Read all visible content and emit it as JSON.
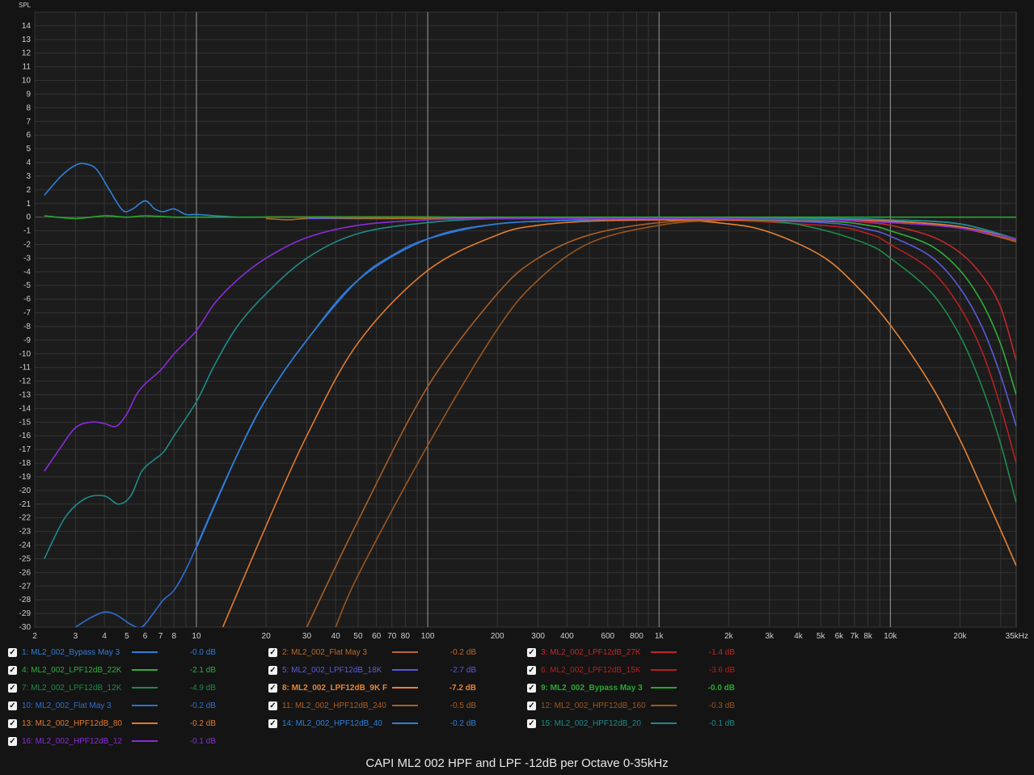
{
  "chart_data": {
    "type": "line",
    "title": "CAPI ML2 002 HPF and LPF -12dB per Octave 0-35kHz",
    "ylabel": "SPL",
    "xscale": "log",
    "xlim": [
      2,
      35000
    ],
    "ylim": [
      -30,
      15
    ],
    "grid": true,
    "y_ticks": [
      "14",
      "13",
      "12",
      "11",
      "10",
      "9",
      "8",
      "7",
      "6",
      "5",
      "4",
      "3",
      "2",
      "1",
      "0",
      "-1",
      "-2",
      "-3",
      "-4",
      "-5",
      "-6",
      "-7",
      "-8",
      "-9",
      "-10",
      "-11",
      "-12",
      "-13",
      "-14",
      "-15",
      "-16",
      "-17",
      "-18",
      "-19",
      "-20",
      "-21",
      "-22",
      "-23",
      "-24",
      "-25",
      "-26",
      "-27",
      "-28",
      "-29",
      "-30"
    ],
    "x_ticks": [
      {
        "v": 2,
        "label": "2"
      },
      {
        "v": 3,
        "label": "3"
      },
      {
        "v": 4,
        "label": "4"
      },
      {
        "v": 5,
        "label": "5"
      },
      {
        "v": 6,
        "label": "6"
      },
      {
        "v": 7,
        "label": "7"
      },
      {
        "v": 8,
        "label": "8"
      },
      {
        "v": 10,
        "label": "10"
      },
      {
        "v": 20,
        "label": "20"
      },
      {
        "v": 30,
        "label": "30"
      },
      {
        "v": 40,
        "label": "40"
      },
      {
        "v": 50,
        "label": "50"
      },
      {
        "v": 60,
        "label": "60"
      },
      {
        "v": 70,
        "label": "70"
      },
      {
        "v": 80,
        "label": "80"
      },
      {
        "v": 100,
        "label": "100"
      },
      {
        "v": 200,
        "label": "200"
      },
      {
        "v": 300,
        "label": "300"
      },
      {
        "v": 400,
        "label": "400"
      },
      {
        "v": 600,
        "label": "600"
      },
      {
        "v": 800,
        "label": "800"
      },
      {
        "v": 1000,
        "label": "1k"
      },
      {
        "v": 2000,
        "label": "2k"
      },
      {
        "v": 3000,
        "label": "3k"
      },
      {
        "v": 4000,
        "label": "4k"
      },
      {
        "v": 5000,
        "label": "5k"
      },
      {
        "v": 6000,
        "label": "6k"
      },
      {
        "v": 7000,
        "label": "7k"
      },
      {
        "v": 8000,
        "label": "8k"
      },
      {
        "v": 10000,
        "label": "10k"
      },
      {
        "v": 20000,
        "label": "20k"
      },
      {
        "v": 35000,
        "label": "35kHz"
      }
    ],
    "series": [
      {
        "name": "1: ML2_002_Bypass May 3",
        "value_label": "-0.0 dB",
        "color": "#2f7fd8",
        "x": [
          2.2,
          2.6,
          3,
          3.3,
          3.7,
          4.2,
          4.8,
          5.3,
          6,
          6.6,
          7.2,
          8,
          9,
          10,
          12,
          15,
          20
        ],
        "y": [
          1.6,
          3.0,
          3.8,
          3.9,
          3.5,
          2.0,
          0.5,
          0.6,
          1.2,
          0.6,
          0.4,
          0.6,
          0.2,
          0.2,
          0.1,
          0.0,
          0.0
        ]
      },
      {
        "name": "2: ML2_002_Flat May 3",
        "value_label": "-0.2 dB",
        "color": "#b86a2c",
        "x": [
          20,
          25,
          30,
          50,
          100,
          500,
          1000,
          5000,
          10000,
          20000,
          35000
        ],
        "y": [
          -0.1,
          -0.2,
          -0.1,
          -0.1,
          -0.1,
          -0.1,
          -0.1,
          -0.2,
          -0.3,
          -0.7,
          -1.8
        ]
      },
      {
        "name": "3: ML2_002_LPF12dB_27K",
        "value_label": "-1.4 dB",
        "color": "#c02828",
        "x": [
          20,
          100,
          1000,
          5000,
          8000,
          10000,
          15000,
          20000,
          25000,
          30000,
          35000
        ],
        "y": [
          0,
          0,
          -0.1,
          -0.2,
          -0.4,
          -0.6,
          -1.4,
          -2.6,
          -4.3,
          -6.6,
          -10.5
        ]
      },
      {
        "name": "4: ML2_002_LPF12dB_22K",
        "value_label": "-2.1 dB",
        "color": "#2fae3a",
        "x": [
          20,
          100,
          1000,
          5000,
          8000,
          10000,
          15000,
          20000,
          25000,
          30000,
          35000
        ],
        "y": [
          0,
          0,
          -0.1,
          -0.3,
          -0.6,
          -1.0,
          -2.1,
          -3.9,
          -6.3,
          -9.3,
          -13.0
        ]
      },
      {
        "name": "5: ML2_002_LPF12dB_18K",
        "value_label": "-2.7 dB",
        "color": "#5a5ad8",
        "x": [
          30,
          100,
          1000,
          5000,
          8000,
          10000,
          15000,
          20000,
          25000,
          30000,
          35000
        ],
        "y": [
          -0.1,
          0,
          -0.1,
          -0.4,
          -0.9,
          -1.4,
          -2.9,
          -5.2,
          -8.1,
          -11.6,
          -15.3
        ]
      },
      {
        "name": "6: ML2_002_LPF12dB_15K",
        "value_label": "-3.6 dB",
        "color": "#b81f1f",
        "x": [
          20,
          100,
          1000,
          5000,
          8000,
          10000,
          15000,
          20000,
          25000,
          30000,
          35000
        ],
        "y": [
          0,
          0,
          -0.1,
          -0.6,
          -1.2,
          -2.0,
          -3.9,
          -6.6,
          -9.9,
          -13.9,
          -18.0
        ]
      },
      {
        "name": "7: ML2_002_LPF12dB_12K",
        "value_label": "-4.9 dB",
        "color": "#1f8a4a",
        "x": [
          20,
          100,
          1000,
          3000,
          5000,
          8000,
          10000,
          15000,
          20000,
          25000,
          30000,
          35000
        ],
        "y": [
          0,
          0,
          -0.1,
          -0.3,
          -0.9,
          -2.0,
          -3.0,
          -5.5,
          -8.7,
          -12.5,
          -16.6,
          -20.9
        ]
      },
      {
        "name": "8: ML2_002_LPF12dB_9K F",
        "value_label": "-7.2 dB",
        "color": "#e68336",
        "x": [
          20,
          100,
          1000,
          2000,
          3000,
          5000,
          7000,
          10000,
          15000,
          20000,
          25000,
          30000,
          35000
        ],
        "y": [
          0,
          0,
          -0.2,
          -0.5,
          -1.1,
          -2.8,
          -4.9,
          -7.9,
          -12.3,
          -16.3,
          -19.9,
          -22.9,
          -25.5
        ]
      },
      {
        "name": "9: ML2_002_Bypass May 3",
        "value_label": "-0.0 dB",
        "color": "#27a82f",
        "x": [
          2.2,
          3,
          4,
          5,
          6,
          8,
          10,
          20,
          35000
        ],
        "y": [
          0.1,
          -0.1,
          0.1,
          0.0,
          0.1,
          0.0,
          0.0,
          0.0,
          0.0
        ]
      },
      {
        "name": "10: ML2_002_Flat May 3",
        "value_label": "-0.2 dB",
        "color": "#2f6fd0",
        "x": [
          3,
          3.5,
          4,
          4.5,
          5.2,
          5.8,
          6.5,
          7.2,
          8,
          9,
          10,
          12,
          15,
          20,
          30,
          50,
          70,
          100,
          200,
          500,
          1000,
          5000,
          10000,
          20000,
          35000
        ],
        "y": [
          -30,
          -29.3,
          -28.9,
          -29.1,
          -29.8,
          -30,
          -29,
          -28,
          -27.3,
          -25.8,
          -24.1,
          -21.0,
          -17.4,
          -13.3,
          -9.0,
          -4.6,
          -2.8,
          -1.6,
          -0.5,
          -0.2,
          -0.1,
          -0.1,
          -0.2,
          -0.5,
          -1.7
        ]
      },
      {
        "name": "11: ML2_002_HPF12dB_240",
        "value_label": "-0.5 dB",
        "color": "#a85e28",
        "x": [
          30,
          50,
          100,
          200,
          300,
          500,
          1000,
          2000,
          5000,
          10000,
          20000,
          35000
        ],
        "y": [
          -30,
          -22.2,
          -12.4,
          -5.6,
          -3.0,
          -1.3,
          -0.4,
          -0.2,
          -0.2,
          -0.4,
          -0.8,
          -1.8
        ]
      },
      {
        "name": "12: ML2_002_HPF12dB_160",
        "value_label": "-0.3 dB",
        "color": "#9a5622",
        "x": [
          40,
          50,
          100,
          200,
          300,
          500,
          1000,
          2000,
          5000,
          10000,
          20000,
          35000
        ],
        "y": [
          -30,
          -26.2,
          -16.7,
          -8.2,
          -4.6,
          -1.9,
          -0.6,
          -0.2,
          -0.2,
          -0.3,
          -0.7,
          -1.7
        ]
      },
      {
        "name": "13: ML2_002_HPF12dB_80",
        "value_label": "-0.2 dB",
        "color": "#e07a30",
        "x": [
          13,
          20,
          30,
          50,
          100,
          200,
          300,
          500,
          1000,
          2000,
          5000,
          10000,
          20000,
          35000
        ],
        "y": [
          -30,
          -22.6,
          -16.0,
          -9.2,
          -3.9,
          -1.3,
          -0.6,
          -0.3,
          -0.2,
          -0.2,
          -0.2,
          -0.3,
          -0.7,
          -1.6
        ]
      },
      {
        "name": "14: ML2_002_HPF12dB_40",
        "value_label": "-0.2 dB",
        "color": "#2f7fd8",
        "x": [
          10,
          15,
          20,
          30,
          50,
          100,
          200,
          500,
          1000,
          5000,
          10000,
          20000,
          35000
        ],
        "y": [
          -24.2,
          -17.4,
          -13.3,
          -9.0,
          -4.6,
          -1.6,
          -0.5,
          -0.2,
          -0.1,
          -0.1,
          -0.2,
          -0.5,
          -1.6
        ]
      },
      {
        "name": "15: ML2_002_HPF12dB_20",
        "value_label": "-0.1 dB",
        "color": "#1f8a8a",
        "x": [
          2.2,
          2.7,
          3.3,
          4,
          4.6,
          5.2,
          5.8,
          6.5,
          7.2,
          8,
          10,
          12,
          15,
          20,
          30,
          50,
          100,
          200,
          500,
          1000,
          5000,
          10000,
          20000,
          35000
        ],
        "y": [
          -25,
          -22,
          -20.6,
          -20.4,
          -21,
          -20.4,
          -18.6,
          -17.8,
          -17.2,
          -16,
          -13.5,
          -10.8,
          -8.0,
          -5.6,
          -3.0,
          -1.2,
          -0.4,
          -0.1,
          -0.1,
          -0.1,
          -0.1,
          -0.2,
          -0.5,
          -1.6
        ]
      },
      {
        "name": "16: ML2_002_HPF12dB_12",
        "value_label": "-0.1 dB",
        "color": "#8a2bd8",
        "x": [
          2.2,
          2.6,
          3,
          3.5,
          4,
          4.5,
          5,
          5.5,
          6,
          7,
          8,
          10,
          12,
          15,
          20,
          30,
          50,
          100,
          200,
          500,
          1000,
          5000,
          10000,
          20000,
          35000
        ],
        "y": [
          -18.6,
          -16.8,
          -15.4,
          -15,
          -15.1,
          -15.3,
          -14.4,
          -13,
          -12.2,
          -11.2,
          -10,
          -8.3,
          -6.3,
          -4.6,
          -3.0,
          -1.5,
          -0.6,
          -0.2,
          -0.1,
          -0.1,
          -0.1,
          -0.2,
          -0.4,
          -0.8,
          -1.6
        ]
      }
    ]
  }
}
